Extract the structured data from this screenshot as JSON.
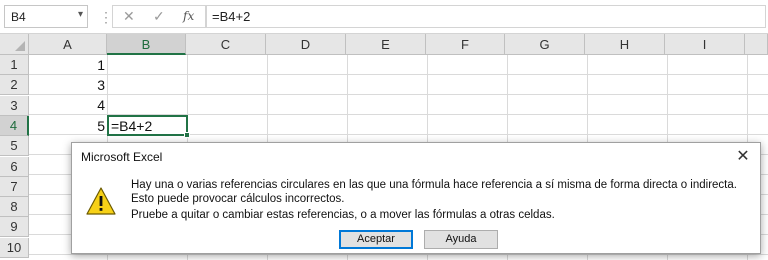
{
  "formula_bar": {
    "name_box": "B4",
    "name_box_dropdown_icon": "chevron-down-icon",
    "cancel_icon": "✕",
    "confirm_icon": "✓",
    "function_icon": "fx",
    "formula": "=B4+2"
  },
  "columns": [
    "A",
    "B",
    "C",
    "D",
    "E",
    "F",
    "G",
    "H",
    "I"
  ],
  "rows": [
    "1",
    "2",
    "3",
    "4",
    "5",
    "6",
    "7",
    "8",
    "9",
    "10"
  ],
  "cells": {
    "A1": "1",
    "A2": "3",
    "A3": "4",
    "A4": "5",
    "B4": "=B4+2"
  },
  "selection": {
    "column": "B",
    "row": "4"
  },
  "dialog": {
    "title": "Microsoft Excel",
    "close_label": "✕",
    "icon": "warning-icon",
    "message_line1": "Hay una o varias referencias circulares en las que una fórmula hace referencia a sí misma de forma directa o indirecta. Esto puede provocar cálculos incorrectos.",
    "message_line2": "Pruebe a quitar o cambiar estas referencias, o a mover las fórmulas a otras celdas.",
    "ok_button": "Aceptar",
    "help_button": "Ayuda"
  },
  "colors": {
    "excel_green": "#217346",
    "focus_blue": "#0078d7",
    "warning_yellow": "#f7d117"
  }
}
